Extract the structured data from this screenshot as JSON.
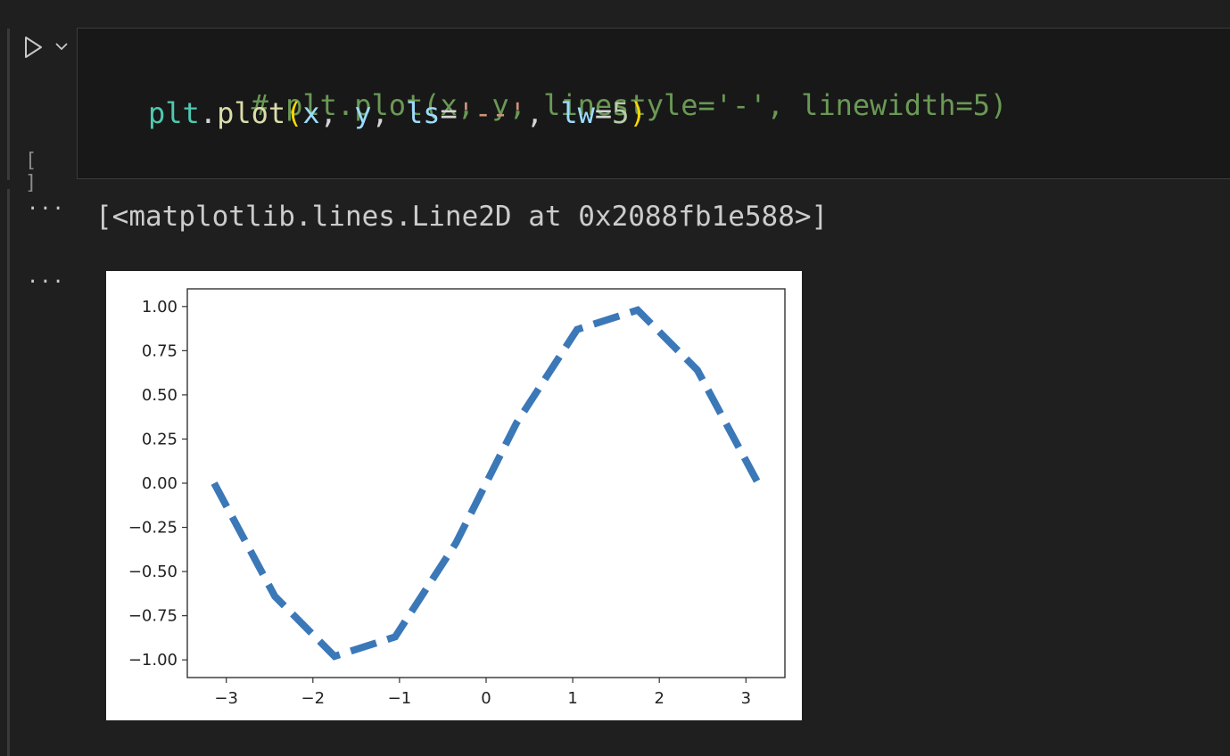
{
  "cell": {
    "exec_count": "[ ]",
    "code": {
      "line1_comment": "# plt.plot(x, y, linestyle='-', linewidth=5)",
      "line2": {
        "obj": "plt",
        "dot": ".",
        "fn": "plot",
        "open": "(",
        "arg_x": "x",
        "comma1": ", ",
        "arg_y": "y",
        "comma2": ", ",
        "kw_ls": "ls",
        "eq1": "=",
        "ls_val": "'--'",
        "comma3": ", ",
        "kw_lw": "lw",
        "eq2": "=",
        "lw_val": "5",
        "close": ")"
      }
    },
    "run_icon": "play-icon",
    "chevron_icon": "chevron-down-icon"
  },
  "output": {
    "more_icon": "ellipsis-icon",
    "more_label": "···",
    "text": "[<matplotlib.lines.Line2D at 0x2088fb1e588>]"
  },
  "colors": {
    "background": "#1f1f1f",
    "line": "#3b78b8",
    "comment": "#6a9955"
  },
  "chart_data": {
    "type": "line",
    "title": "",
    "xlabel": "",
    "ylabel": "",
    "xlim": [
      -3.45,
      3.45
    ],
    "ylim": [
      -1.1,
      1.1
    ],
    "xticks": [
      -3,
      -2,
      -1,
      0,
      1,
      2,
      3
    ],
    "xtick_labels": [
      "−3",
      "−2",
      "−1",
      "0",
      "1",
      "2",
      "3"
    ],
    "yticks": [
      1.0,
      0.75,
      0.5,
      0.25,
      0.0,
      -0.25,
      -0.5,
      -0.75,
      -1.0
    ],
    "ytick_labels": [
      "1.00",
      "0.75",
      "0.50",
      "0.25",
      "0.00",
      "−0.25",
      "−0.50",
      "−0.75",
      "−1.00"
    ],
    "linestyle": "dashed",
    "series": [
      {
        "x": [
          -3.14,
          -2.44,
          -1.75,
          -1.05,
          -0.35,
          0.35,
          1.05,
          1.75,
          2.44,
          3.14
        ],
        "y": [
          0.0,
          -0.64,
          -0.98,
          -0.87,
          -0.34,
          0.34,
          0.87,
          0.98,
          0.64,
          0.0
        ]
      }
    ],
    "grid": false,
    "legend": false
  }
}
